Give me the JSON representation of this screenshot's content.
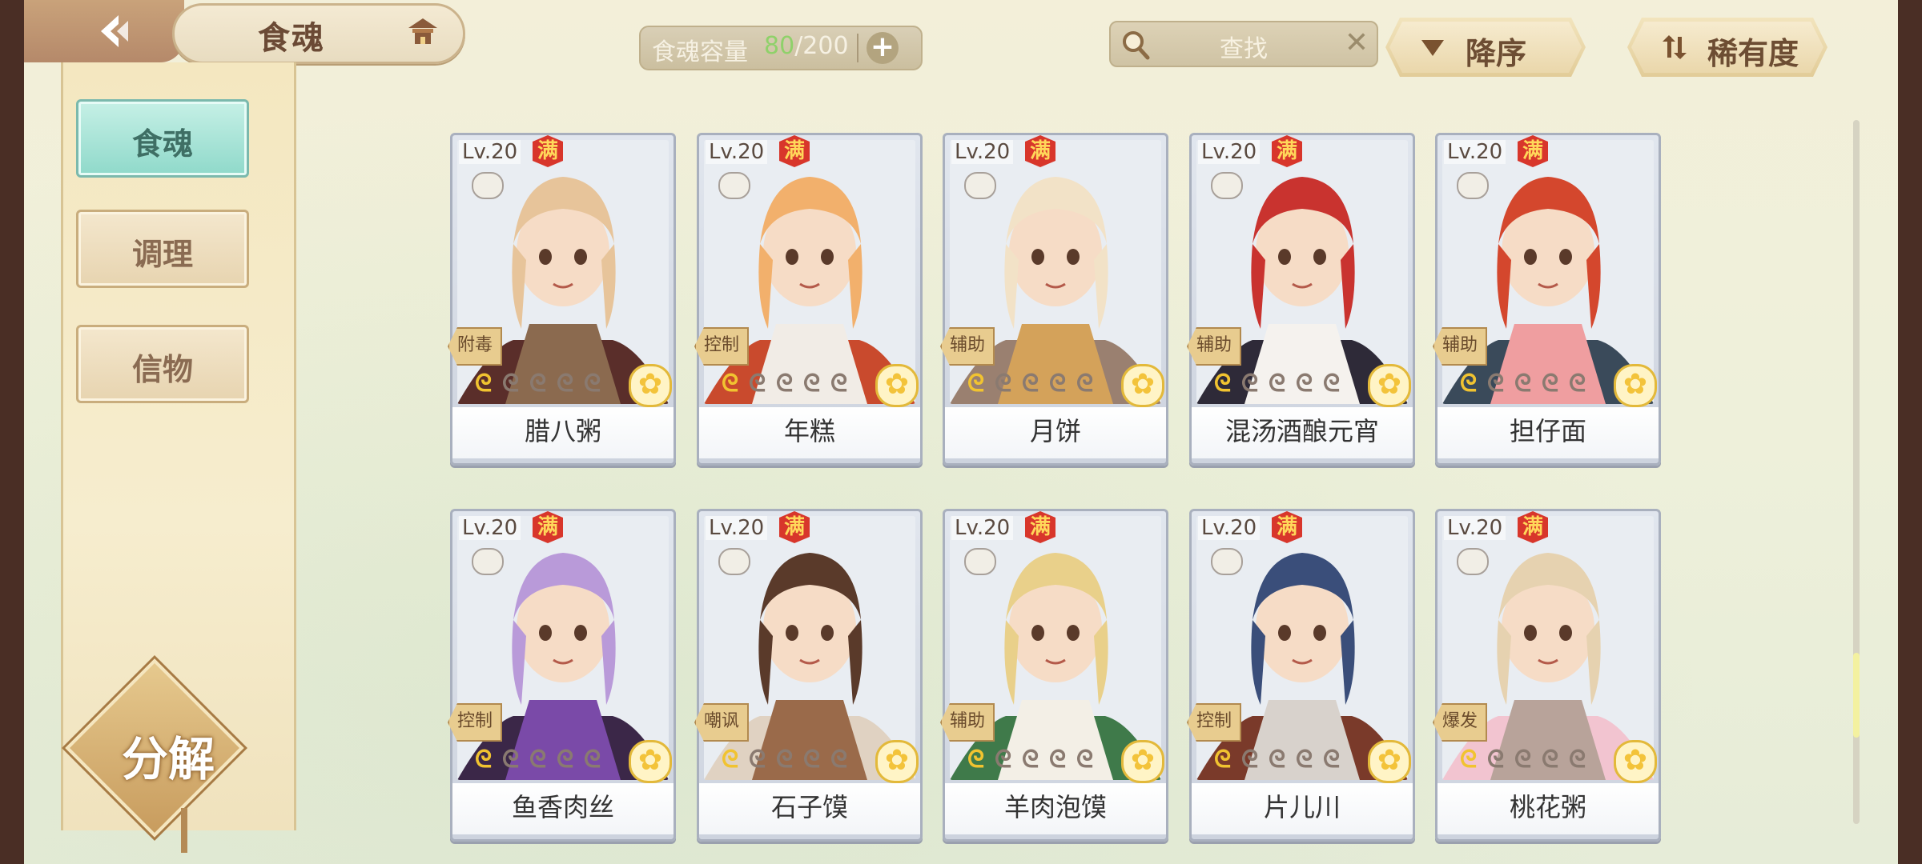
{
  "header": {
    "title": "食魂",
    "capacity_label": "食魂容量",
    "capacity_current": "80",
    "capacity_total": "/200",
    "search_placeholder": "查找",
    "sort_order_label": "降序",
    "sort_by_label": "稀有度"
  },
  "sidebar": {
    "items": [
      {
        "label": "食魂",
        "active": true
      },
      {
        "label": "调理",
        "active": false
      },
      {
        "label": "信物",
        "active": false
      }
    ],
    "decompose_label": "分解"
  },
  "cards": [
    {
      "level": "Lv.20",
      "badge": "满",
      "role": "附毒",
      "stars_filled": 1,
      "name": "腊八粥",
      "art_colors": [
        "#8b6a4f",
        "#5a2e2a",
        "#e7c49a"
      ]
    },
    {
      "level": "Lv.20",
      "badge": "满",
      "role": "控制",
      "stars_filled": 1,
      "name": "年糕",
      "art_colors": [
        "#f1ece6",
        "#c94a2d",
        "#f2b06c"
      ]
    },
    {
      "level": "Lv.20",
      "badge": "满",
      "role": "辅助",
      "stars_filled": 1,
      "name": "月饼",
      "art_colors": [
        "#d4a25a",
        "#9a8070",
        "#f2e2c7"
      ]
    },
    {
      "level": "Lv.20",
      "badge": "满",
      "role": "辅助",
      "stars_filled": 1,
      "name": "混汤酒酿元宵",
      "art_colors": [
        "#f5f2ee",
        "#2e2a38",
        "#c9332f"
      ]
    },
    {
      "level": "Lv.20",
      "badge": "满",
      "role": "辅助",
      "stars_filled": 1,
      "name": "担仔面",
      "art_colors": [
        "#ef9ea0",
        "#3a4a5a",
        "#d4472d"
      ]
    },
    {
      "level": "Lv.20",
      "badge": "满",
      "role": "控制",
      "stars_filled": 1,
      "name": "鱼香肉丝",
      "art_colors": [
        "#7a4aa8",
        "#3b2748",
        "#b99ad9"
      ]
    },
    {
      "level": "Lv.20",
      "badge": "满",
      "role": "嘲讽",
      "stars_filled": 1,
      "name": "石子馍",
      "art_colors": [
        "#9a6a4a",
        "#e0d2c2",
        "#5a3a2a"
      ]
    },
    {
      "level": "Lv.20",
      "badge": "满",
      "role": "辅助",
      "stars_filled": 1,
      "name": "羊肉泡馍",
      "art_colors": [
        "#f3efe6",
        "#3f7a4a",
        "#e9d08a"
      ]
    },
    {
      "level": "Lv.20",
      "badge": "满",
      "role": "控制",
      "stars_filled": 1,
      "name": "片儿川",
      "art_colors": [
        "#d8d2cc",
        "#7a3a2a",
        "#3a4e7a"
      ]
    },
    {
      "level": "Lv.20",
      "badge": "满",
      "role": "爆发",
      "stars_filled": 1,
      "name": "桃花粥",
      "art_colors": [
        "#b8a39a",
        "#f2c4d0",
        "#e6d2b0"
      ]
    }
  ],
  "scroll": {
    "position": 0.77
  }
}
